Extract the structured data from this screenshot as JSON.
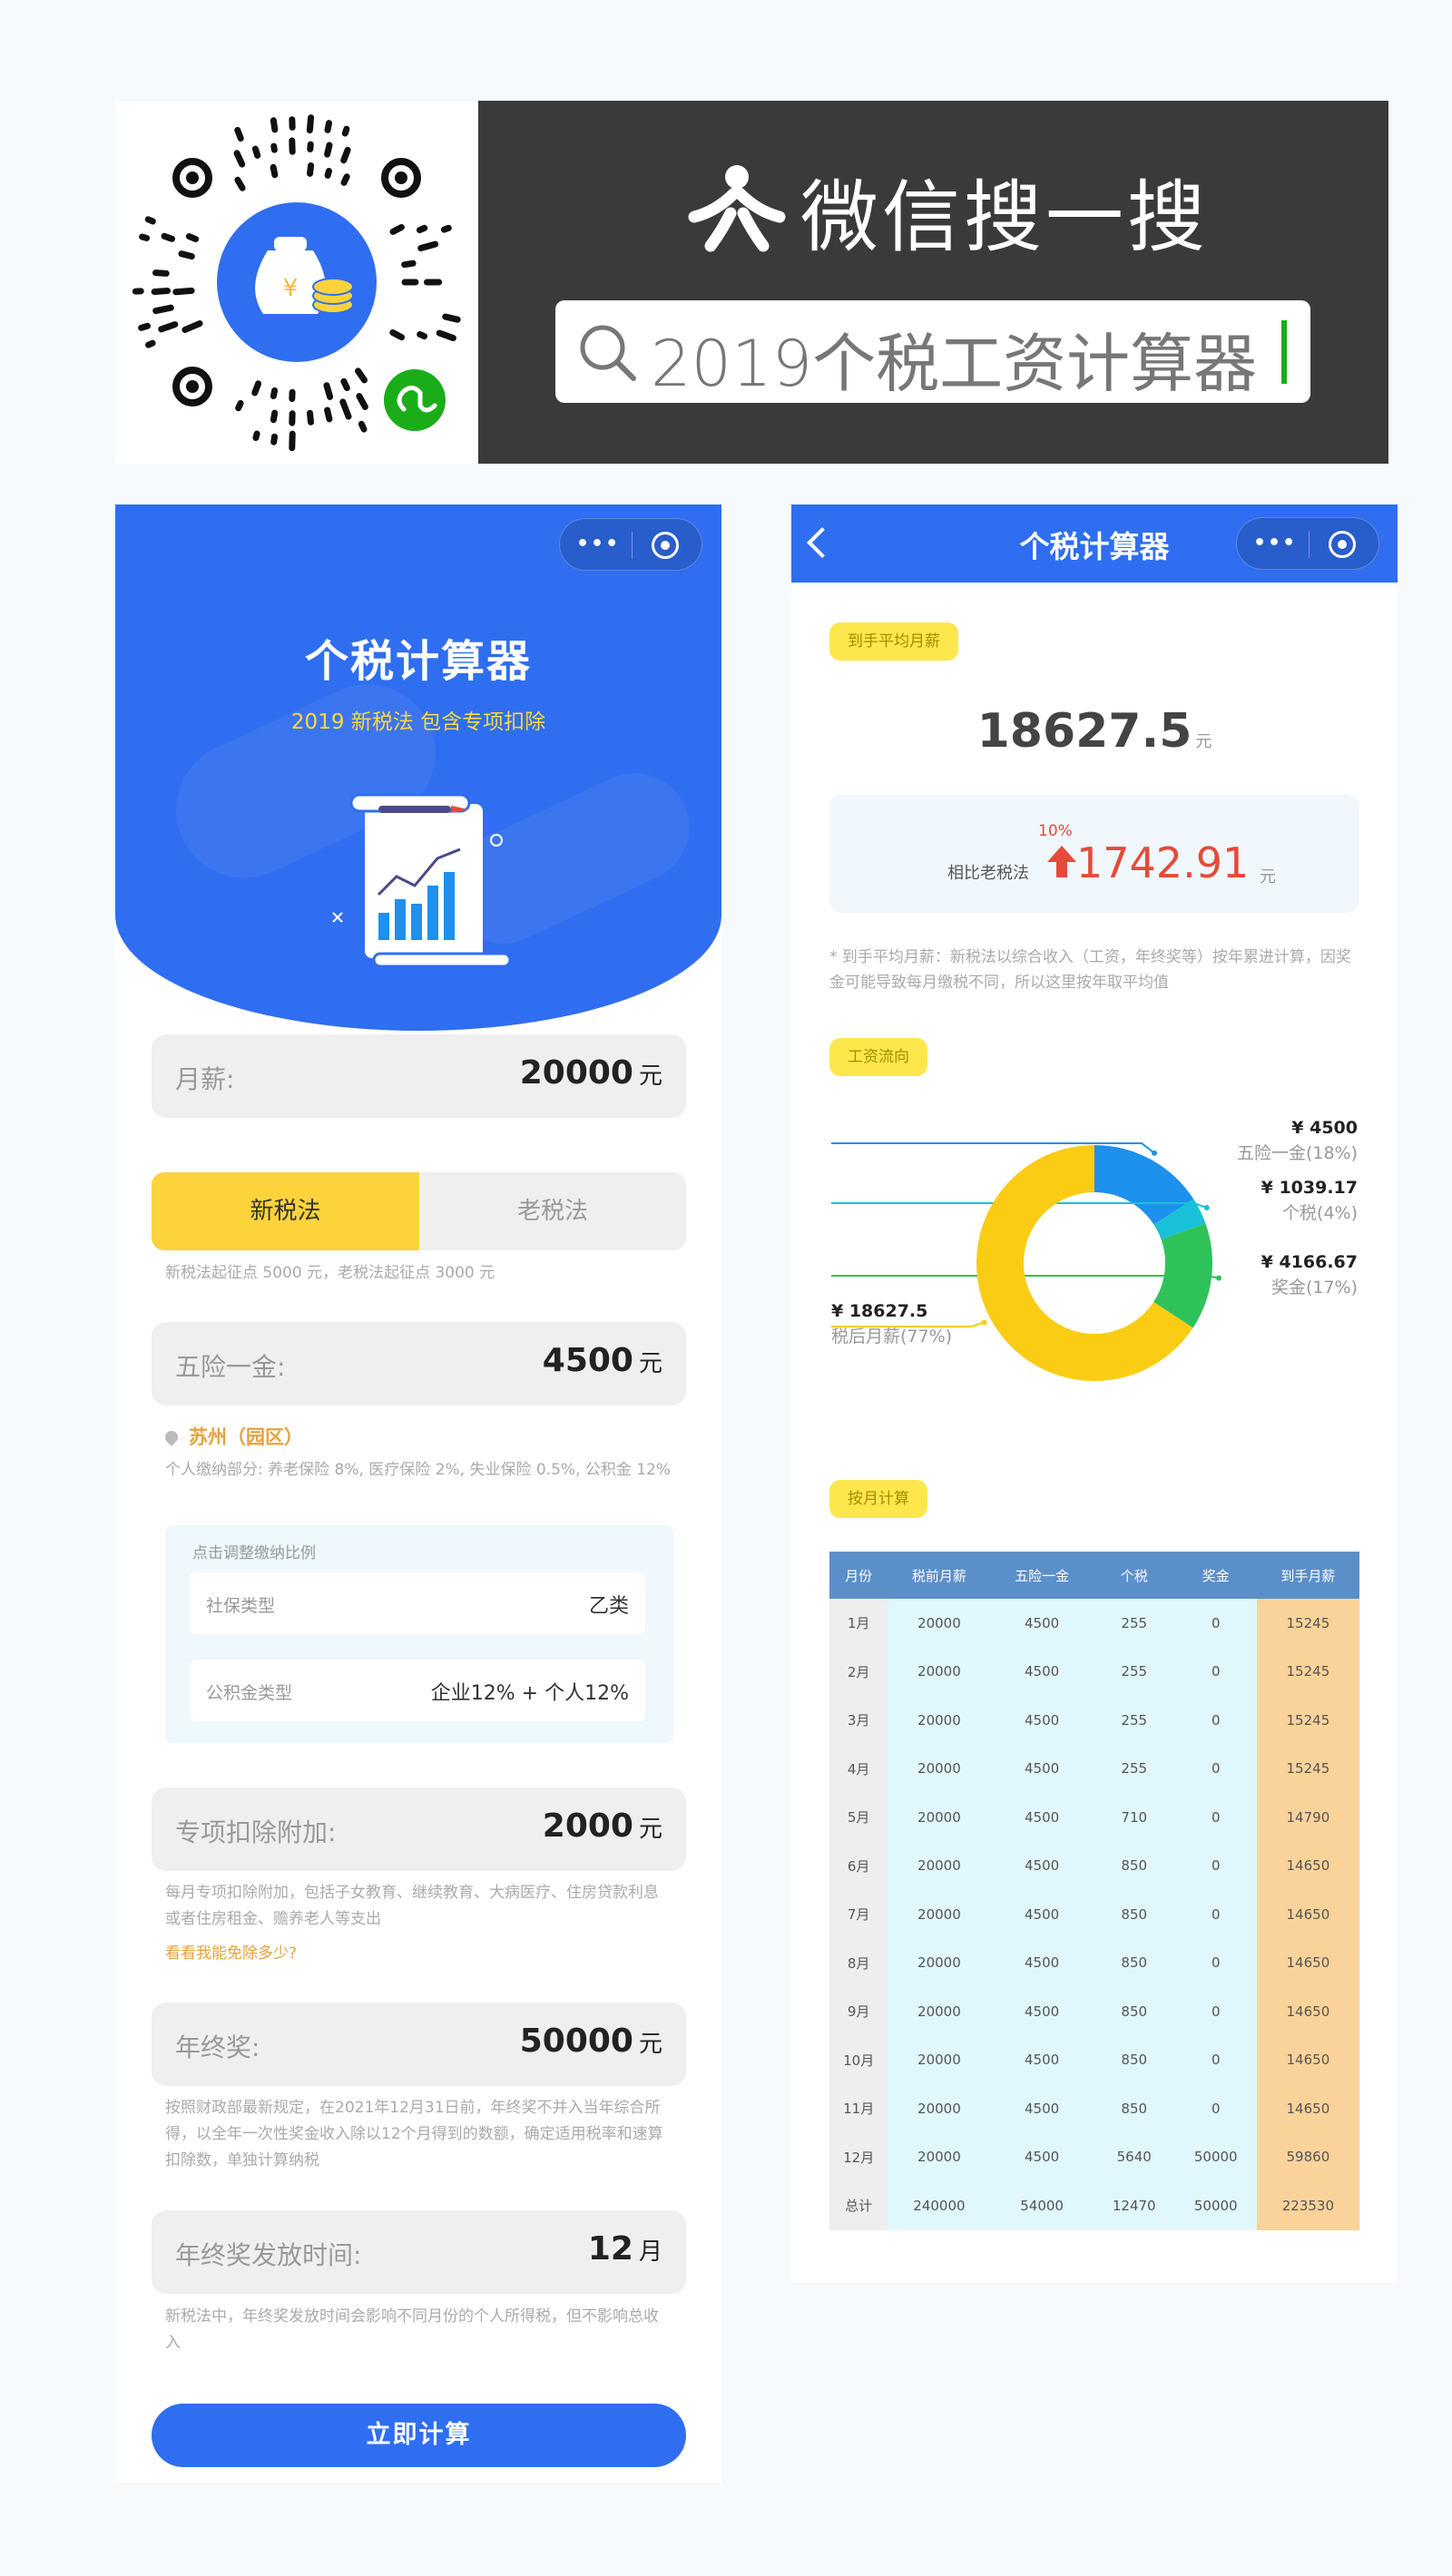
{
  "banner": {
    "wechat_title": "微信搜一搜",
    "search_query": "2019个税工资计算器"
  },
  "left": {
    "hero_title": "个税计算器",
    "hero_subtitle": "2019 新税法 包含专项扣除",
    "salary": {
      "label": "月薪:",
      "value": "20000",
      "unit": "元"
    },
    "toggle": {
      "new": "新税法",
      "old": "老税法"
    },
    "threshold_note": "新税法起征点 5000 元，老税法起征点 3000 元",
    "insurance": {
      "label": "五险一金:",
      "value": "4500",
      "unit": "元"
    },
    "city": "苏州（园区）",
    "contrib_note": "个人缴纳部分: 养老保险 8%, 医疗保险 2%, 失业保险 0.5%, 公积金 12%",
    "adjust": {
      "title": "点击调整缴纳比例",
      "social_label": "社保类型",
      "social_value": "乙类",
      "fund_label": "公积金类型",
      "fund_value": "企业12% + 个人12%"
    },
    "special": {
      "label": "专项扣除附加:",
      "value": "2000",
      "unit": "元"
    },
    "special_note": "每月专项扣除附加，包括子女教育、继续教育、大病医疗、住房贷款利息或者住房租金、赡养老人等支出",
    "special_link": "看看我能免除多少?",
    "bonus": {
      "label": "年终奖:",
      "value": "50000",
      "unit": "元"
    },
    "bonus_note": "按照财政部最新规定，在2021年12月31日前，年终奖不并入当年综合所得，以全年一次性奖金收入除以12个月得到的数额，确定适用税率和速算扣除数，单独计算纳税",
    "bonus_month": {
      "label": "年终奖发放时间:",
      "value": "12",
      "unit": "月"
    },
    "bonus_month_note": "新税法中，年终奖发放时间会影响不同月份的个人所得税，但不影响总收入",
    "calc_button": "立即计算"
  },
  "right": {
    "nav_title": "个税计算器",
    "avg_pill": "到手平均月薪",
    "avg_value": "18627.5",
    "avg_unit": "元",
    "compare": {
      "percent": "10%",
      "label": "相比老税法",
      "value": "1742.91",
      "unit": "元"
    },
    "footnote": "* 到手平均月薪：新税法以综合收入（工资，年终奖等）按年累进计算，因奖金可能导致每月缴税不同，所以这里按年取平均值",
    "flow_pill": "工资流向",
    "monthly_pill": "按月计算"
  },
  "chart_data": {
    "type": "pie",
    "variant": "donut",
    "slices": [
      {
        "name": "五险一金",
        "value": 4500,
        "percent": "18%",
        "label": "¥ 4500",
        "sub": "五险一金(18%)",
        "color": "#1e90ee"
      },
      {
        "name": "个税",
        "value": 1039.17,
        "percent": "4%",
        "label": "¥ 1039.17",
        "sub": "个税(4%)",
        "color": "#19c1d8"
      },
      {
        "name": "奖金",
        "value": 4166.67,
        "percent": "17%",
        "label": "¥ 4166.67",
        "sub": "奖金(17%)",
        "color": "#2fc25b"
      },
      {
        "name": "税后月薪",
        "value": 18627.5,
        "percent": "77%",
        "label": "¥ 18627.5",
        "sub": "税后月薪(77%)",
        "color": "#facc14"
      }
    ]
  },
  "table": {
    "headers": [
      "月份",
      "税前月薪",
      "五险一金",
      "个税",
      "奖金",
      "到手月薪"
    ],
    "rows": [
      [
        "1月",
        "20000",
        "4500",
        "255",
        "0",
        "15245"
      ],
      [
        "2月",
        "20000",
        "4500",
        "255",
        "0",
        "15245"
      ],
      [
        "3月",
        "20000",
        "4500",
        "255",
        "0",
        "15245"
      ],
      [
        "4月",
        "20000",
        "4500",
        "255",
        "0",
        "15245"
      ],
      [
        "5月",
        "20000",
        "4500",
        "710",
        "0",
        "14790"
      ],
      [
        "6月",
        "20000",
        "4500",
        "850",
        "0",
        "14650"
      ],
      [
        "7月",
        "20000",
        "4500",
        "850",
        "0",
        "14650"
      ],
      [
        "8月",
        "20000",
        "4500",
        "850",
        "0",
        "14650"
      ],
      [
        "9月",
        "20000",
        "4500",
        "850",
        "0",
        "14650"
      ],
      [
        "10月",
        "20000",
        "4500",
        "850",
        "0",
        "14650"
      ],
      [
        "11月",
        "20000",
        "4500",
        "850",
        "0",
        "14650"
      ],
      [
        "12月",
        "20000",
        "4500",
        "5640",
        "50000",
        "59860"
      ],
      [
        "总计",
        "240000",
        "54000",
        "12470",
        "50000",
        "223530"
      ]
    ]
  },
  "colors": {
    "primary": "#2f6ef0",
    "accent_yellow": "#fdd33c",
    "up_red": "#e64a3a",
    "wechat_green": "#1aad19"
  },
  "icons": [
    "wechat-search-icon",
    "magnifier-icon",
    "more-dots-icon",
    "close-ring-icon",
    "back-chevron-icon",
    "location-pin-icon",
    "up-arrow-icon",
    "mini-program-icon",
    "money-bag-icon"
  ]
}
